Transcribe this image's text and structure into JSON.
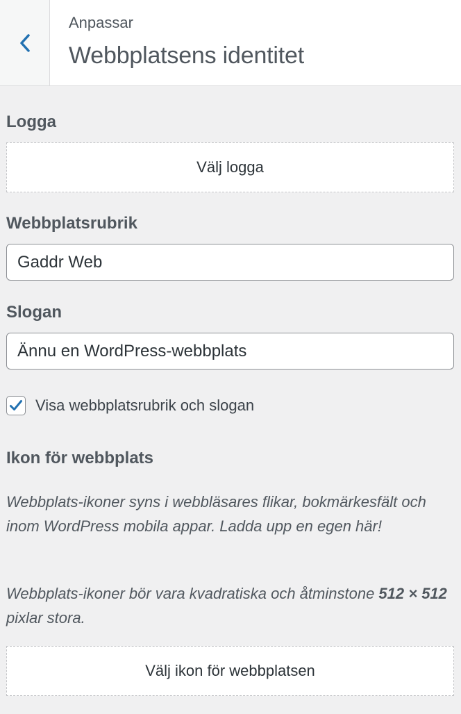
{
  "header": {
    "breadcrumb": "Anpassar",
    "title": "Webbplatsens identitet",
    "back_icon": "chevron-left-icon",
    "accent_color": "#2271b1"
  },
  "logo": {
    "label": "Logga",
    "button_label": "Välj logga"
  },
  "site_title": {
    "label": "Webbplatsrubrik",
    "value": "Gaddr Web"
  },
  "tagline": {
    "label": "Slogan",
    "value": "Ännu en WordPress-webbplats"
  },
  "display_header_text": {
    "label": "Visa webbplatsrubrik och slogan",
    "checked": true
  },
  "site_icon": {
    "label": "Ikon för webbplats",
    "description_1": "Webbplats-ikoner syns i webbläsares flikar, bokmärkesfält och inom WordPress mobila appar. Ladda upp en egen här!",
    "description_2_prefix": "Webbplats-ikoner bör vara kvadratiska och åtminstone ",
    "description_2_size": "512 × 512",
    "description_2_suffix": " pixlar stora.",
    "button_label": "Välj ikon för webbplatsen"
  }
}
